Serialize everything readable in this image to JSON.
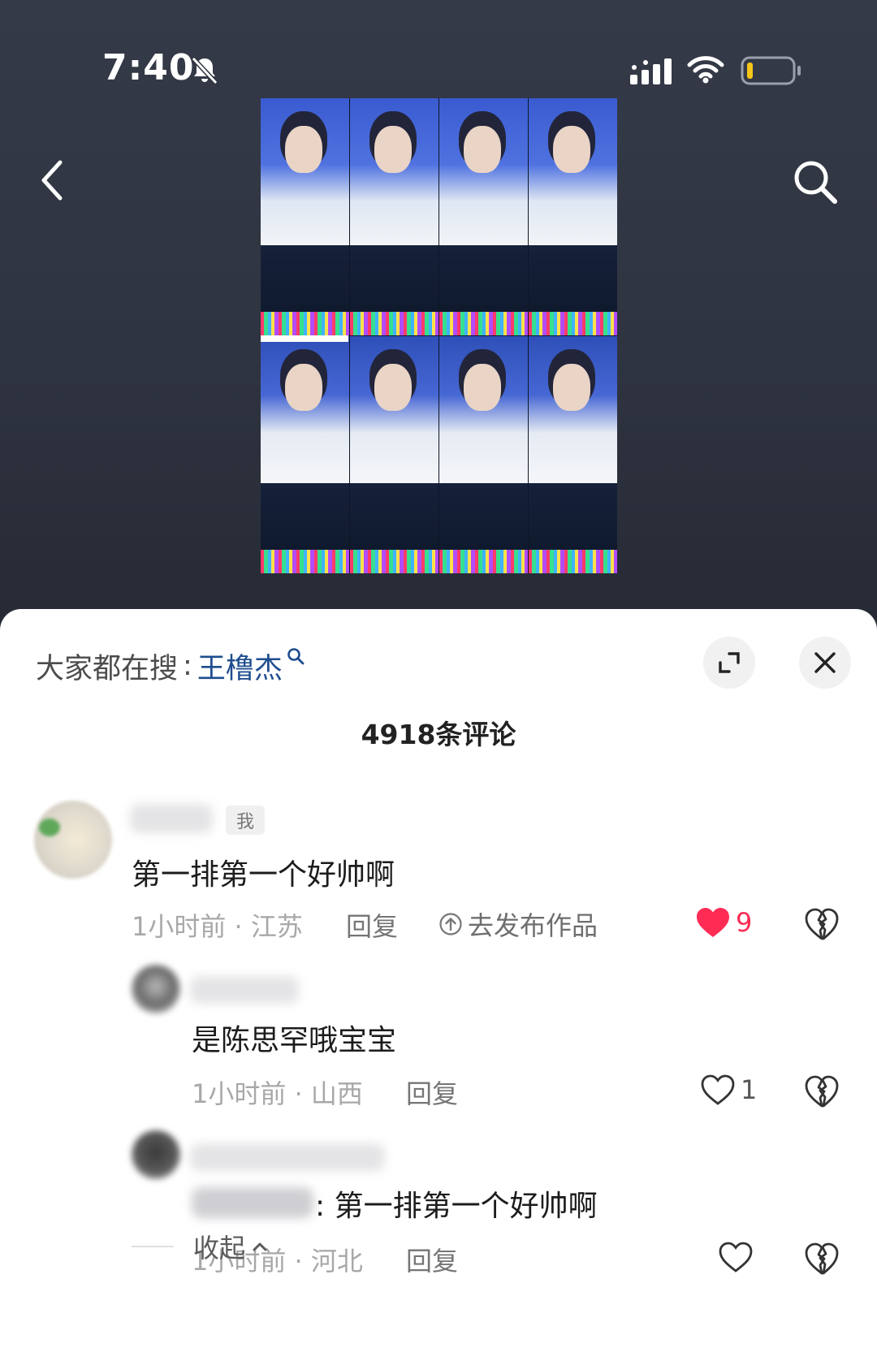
{
  "status_bar": {
    "time": "7:40",
    "icons": [
      "bell-muted-icon",
      "cellular-signal-icon",
      "wifi-icon",
      "battery-low-icon"
    ],
    "battery_color": "#f5c518"
  },
  "nav": {
    "back_icon": "chevron-left-icon",
    "search_icon": "search-icon"
  },
  "post_image": {
    "type": "photo-grid",
    "rows": 2,
    "columns": 4
  },
  "comments_sheet": {
    "hot_search": {
      "prefix": "大家都在搜",
      "colon": ":",
      "keyword": "王橹杰",
      "keyword_color": "#1e4d8f"
    },
    "expand_icon": "expand-icon",
    "close_icon": "close-icon",
    "comment_count_label": "4918条评论",
    "comments": [
      {
        "tag": "我",
        "text": "第一排第一个好帅啊",
        "time_location": "1小时前 · 江苏",
        "reply_label": "回复",
        "publish_label": "去发布作品",
        "likes": "9",
        "liked": true,
        "like_color": "#fe2c55"
      }
    ],
    "replies": [
      {
        "text": "是陈思罕哦宝宝",
        "time_location": "1小时前 · 山西",
        "reply_label": "回复",
        "likes": "1"
      },
      {
        "text": ": 第一排第一个好帅啊",
        "time_location": "1小时前 · 河北",
        "reply_label": "回复",
        "likes": ""
      }
    ],
    "collapse_label": "收起"
  }
}
